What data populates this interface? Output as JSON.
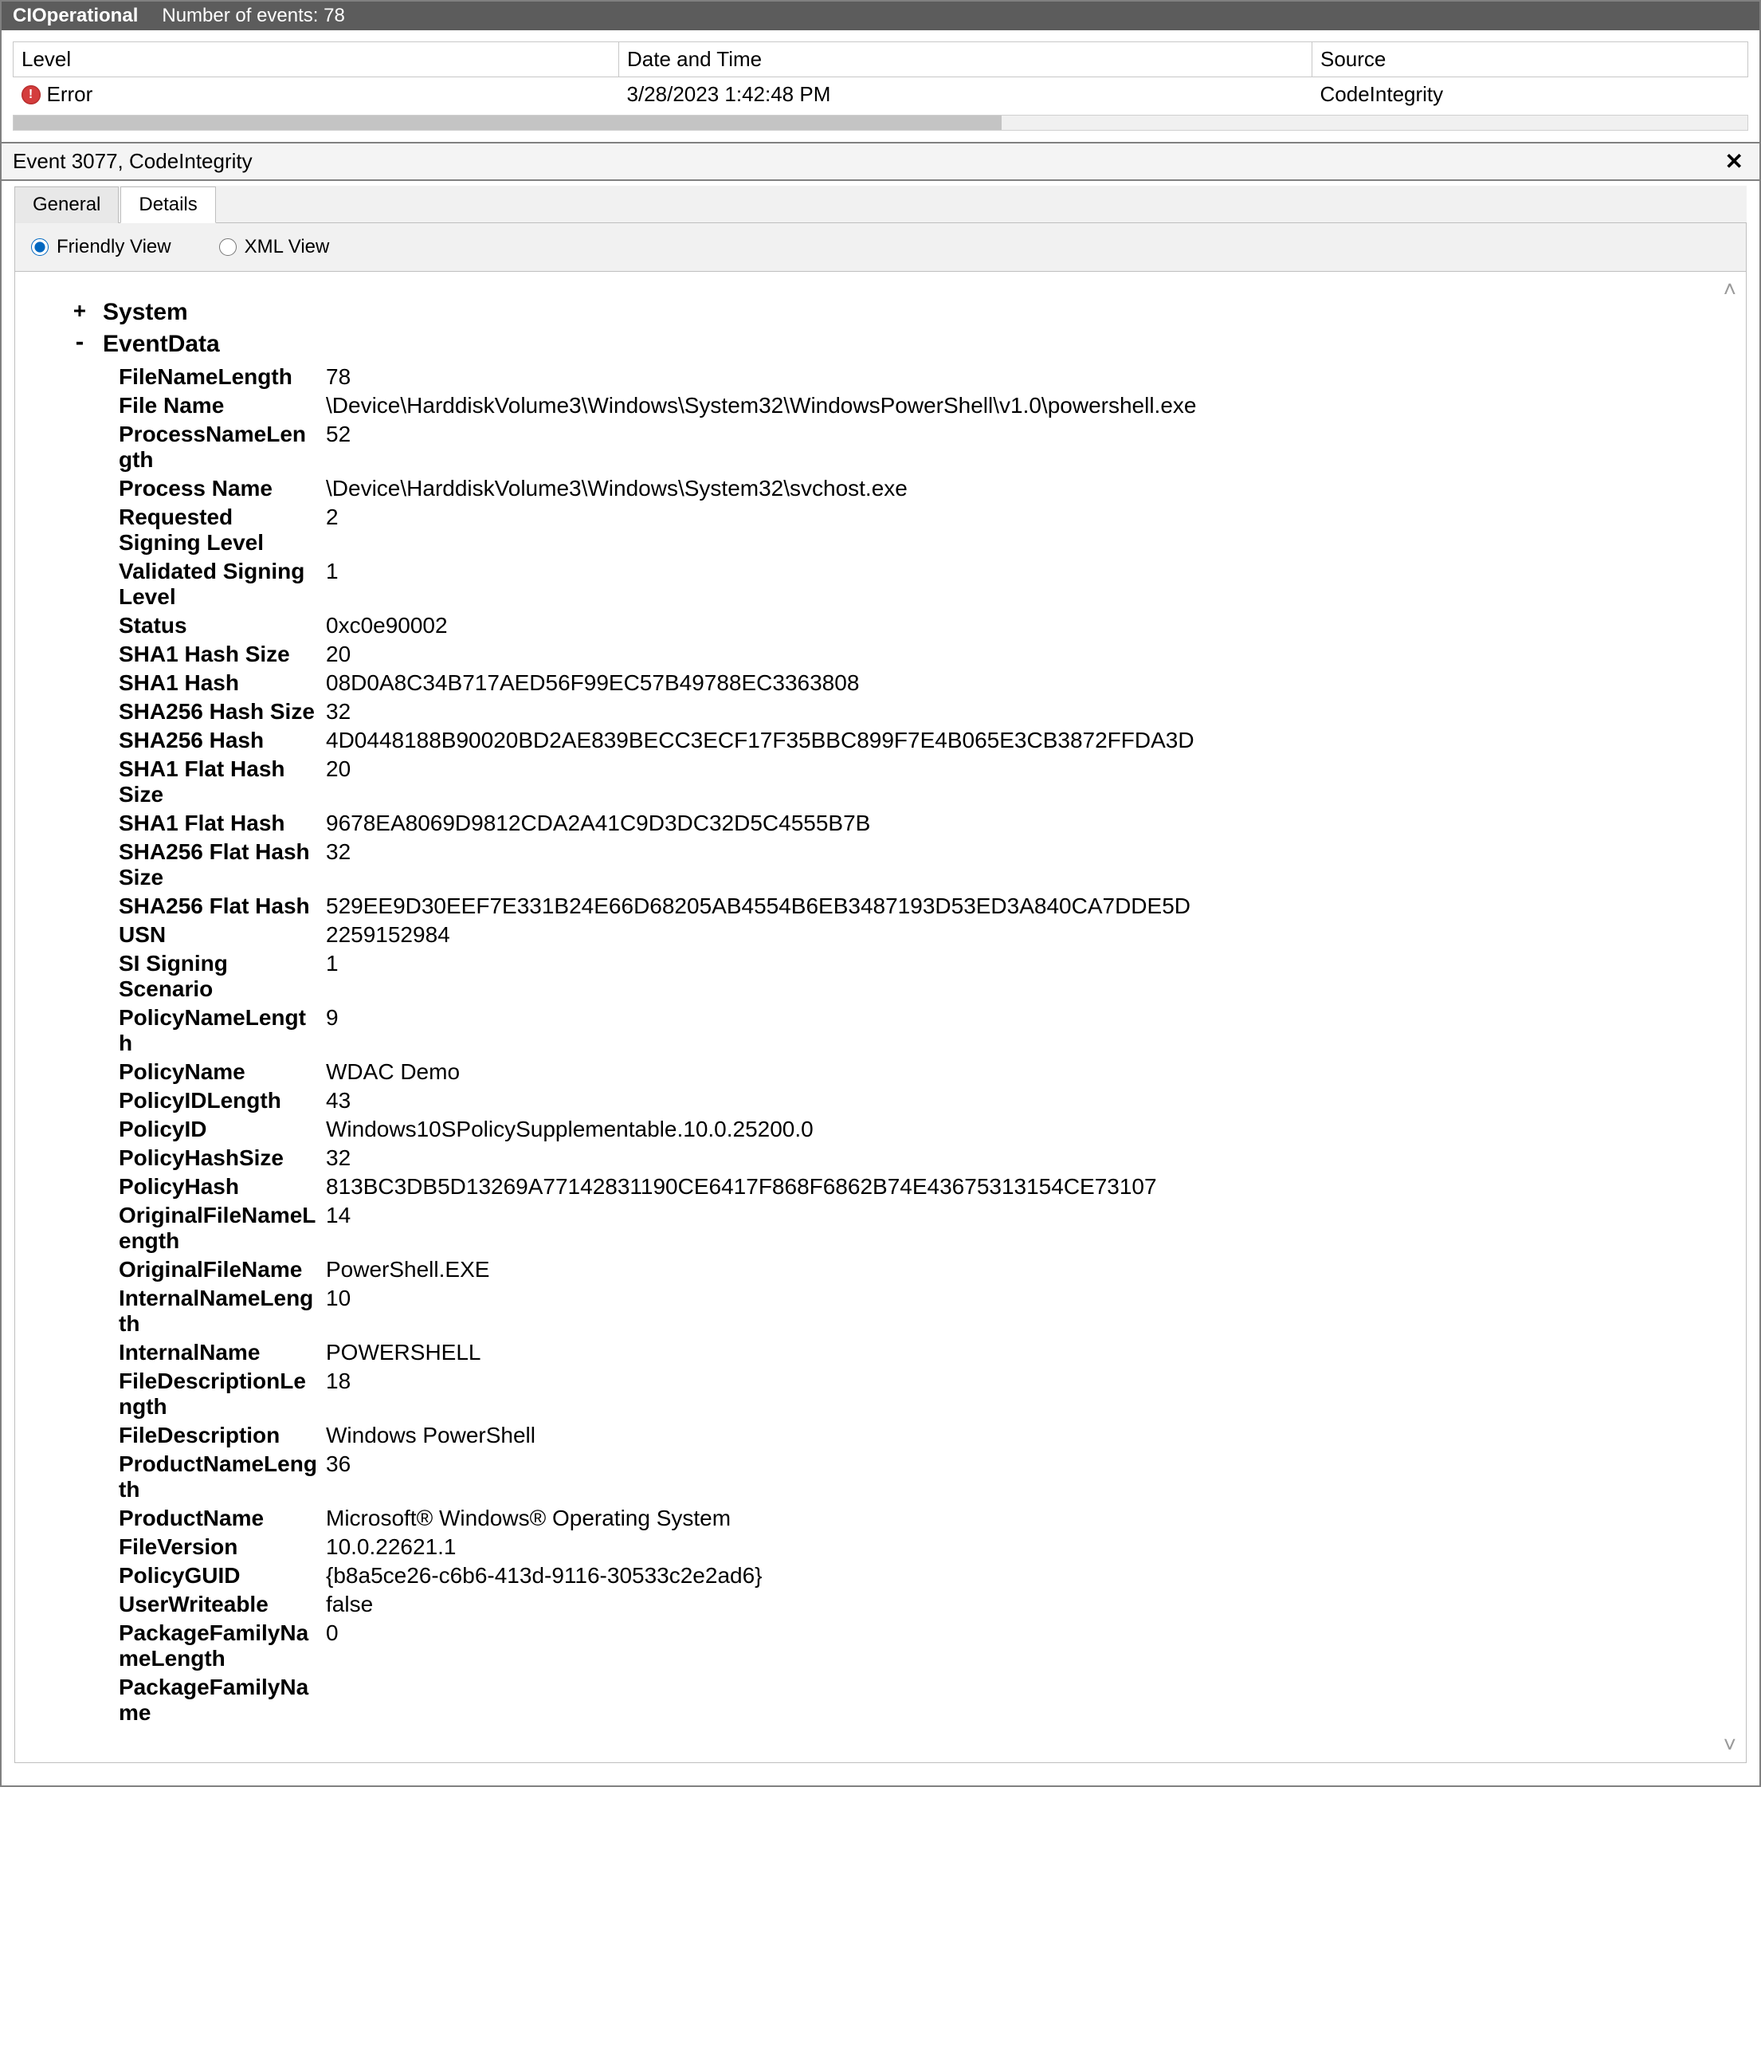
{
  "colors": {
    "titlebar_bg": "#5c5c5c",
    "accent": "#0067c0"
  },
  "titlebar": {
    "title": "CIOperational",
    "subtitle": "Number of events: 78"
  },
  "grid": {
    "headers": {
      "level": "Level",
      "date": "Date and Time",
      "source": "Source"
    },
    "rows": [
      {
        "level": "Error",
        "date": "3/28/2023 1:42:48 PM",
        "source": "CodeIntegrity"
      }
    ]
  },
  "preview_header": "Event 3077, CodeIntegrity",
  "tabs": {
    "general": "General",
    "details": "Details",
    "active": "details"
  },
  "viewmode": {
    "friendly": "Friendly View",
    "xml": "XML View",
    "selected": "friendly"
  },
  "tree": {
    "system_label": "System",
    "eventdata_label": "EventData"
  },
  "event_data": [
    {
      "key": "FileNameLength",
      "value": "78"
    },
    {
      "key": "File Name",
      "value": "\\Device\\HarddiskVolume3\\Windows\\System32\\WindowsPowerShell\\v1.0\\powershell.exe"
    },
    {
      "key": "ProcessNameLength",
      "value": "52"
    },
    {
      "key": "Process Name",
      "value": "\\Device\\HarddiskVolume3\\Windows\\System32\\svchost.exe"
    },
    {
      "key": "Requested Signing Level",
      "value": "2"
    },
    {
      "key": "Validated Signing Level",
      "value": "1"
    },
    {
      "key": "Status",
      "value": "0xc0e90002"
    },
    {
      "key": "SHA1 Hash Size",
      "value": "20"
    },
    {
      "key": "SHA1 Hash",
      "value": "08D0A8C34B717AED56F99EC57B49788EC3363808"
    },
    {
      "key": "SHA256 Hash Size",
      "value": "32"
    },
    {
      "key": "SHA256 Hash",
      "value": "4D0448188B90020BD2AE839BECC3ECF17F35BBC899F7E4B065E3CB3872FFDA3D"
    },
    {
      "key": "SHA1 Flat Hash Size",
      "value": "20"
    },
    {
      "key": "SHA1 Flat Hash",
      "value": "9678EA8069D9812CDA2A41C9D3DC32D5C4555B7B"
    },
    {
      "key": "SHA256 Flat Hash Size",
      "value": "32"
    },
    {
      "key": "SHA256 Flat Hash",
      "value": "529EE9D30EEF7E331B24E66D68205AB4554B6EB3487193D53ED3A840CA7DDE5D"
    },
    {
      "key": "USN",
      "value": "2259152984"
    },
    {
      "key": "SI Signing Scenario",
      "value": "1"
    },
    {
      "key": "PolicyNameLength",
      "value": "9"
    },
    {
      "key": "PolicyName",
      "value": "WDAC Demo"
    },
    {
      "key": "PolicyIDLength",
      "value": "43"
    },
    {
      "key": "PolicyID",
      "value": "Windows10SPolicySupplementable.10.0.25200.0"
    },
    {
      "key": "PolicyHashSize",
      "value": "32"
    },
    {
      "key": "PolicyHash",
      "value": "813BC3DB5D13269A77142831190CE6417F868F6862B74E43675313154CE73107"
    },
    {
      "key": "OriginalFileNameLength",
      "value": "14"
    },
    {
      "key": "OriginalFileName",
      "value": "PowerShell.EXE"
    },
    {
      "key": "InternalNameLength",
      "value": "10"
    },
    {
      "key": "InternalName",
      "value": "POWERSHELL"
    },
    {
      "key": "FileDescriptionLength",
      "value": "18"
    },
    {
      "key": "FileDescription",
      "value": "Windows PowerShell"
    },
    {
      "key": "ProductNameLength",
      "value": "36"
    },
    {
      "key": "ProductName",
      "value": "Microsoft® Windows® Operating System"
    },
    {
      "key": "FileVersion",
      "value": "10.0.22621.1"
    },
    {
      "key": "PolicyGUID",
      "value": "{b8a5ce26-c6b6-413d-9116-30533c2e2ad6}"
    },
    {
      "key": "UserWriteable",
      "value": "false"
    },
    {
      "key": "PackageFamilyNameLength",
      "value": "0"
    },
    {
      "key": "PackageFamilyName",
      "value": ""
    }
  ]
}
